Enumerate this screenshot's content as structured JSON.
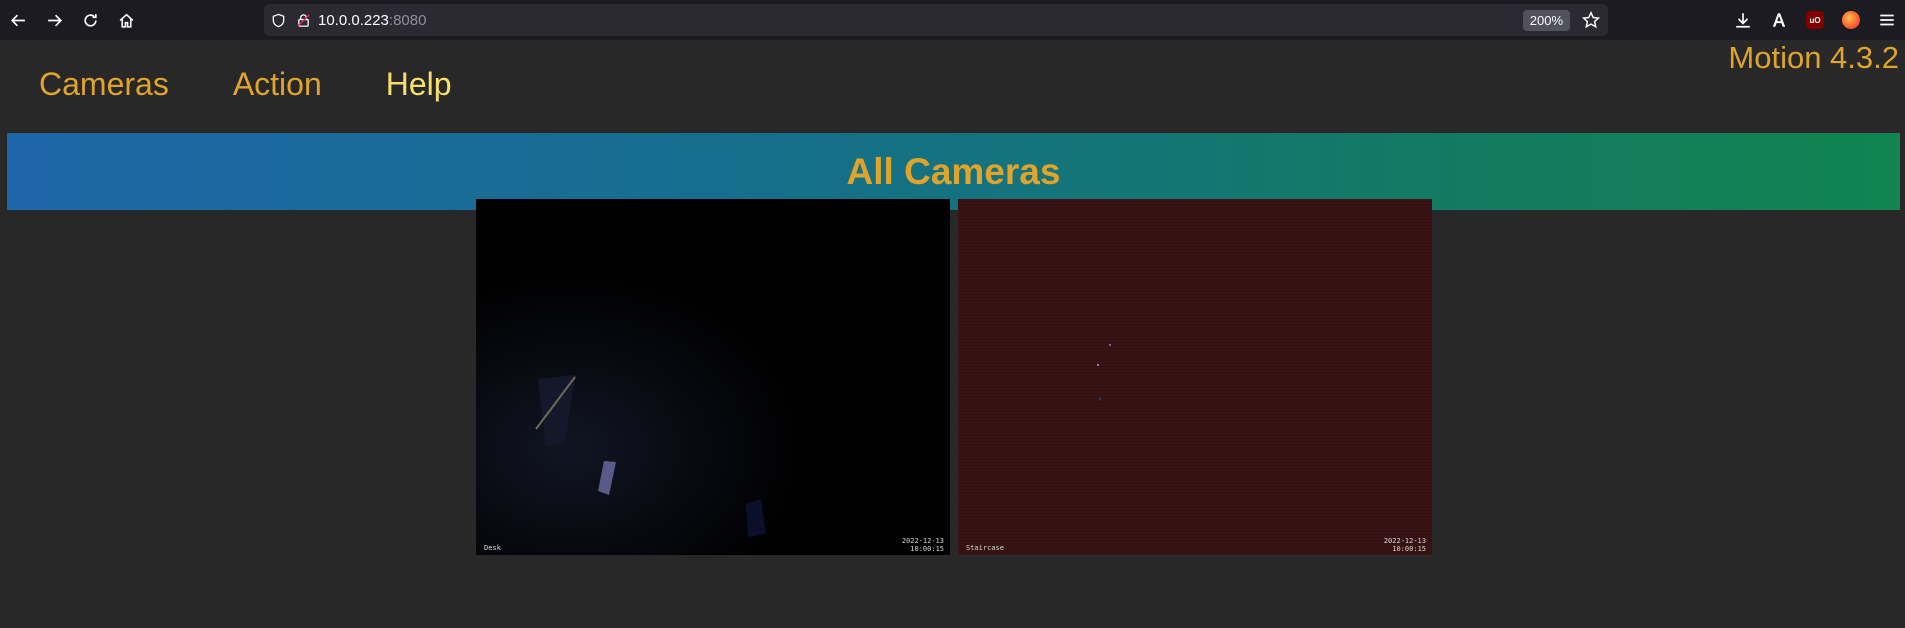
{
  "browser": {
    "url_host": "10.0.0.223",
    "url_port": ":8080",
    "zoom": "200%"
  },
  "icons": {
    "back": "back-arrow-icon",
    "forward": "forward-arrow-icon",
    "reload": "reload-icon",
    "home": "home-icon",
    "shield": "tracking-shield-icon",
    "lock": "insecure-lock-icon",
    "star": "bookmark-star-icon",
    "download": "download-icon",
    "reader": "font-a-icon",
    "ublock": "ublock-origin-icon",
    "fox": "firefox-account-icon",
    "menu": "hamburger-menu-icon"
  },
  "header": {
    "version": "Motion 4.3.2"
  },
  "menu": {
    "items": [
      {
        "label": "Cameras"
      },
      {
        "label": "Action"
      },
      {
        "label": "Help"
      }
    ]
  },
  "banner": {
    "title": "All Cameras"
  },
  "cameras": [
    {
      "label": "Desk",
      "date": "2022-12-13",
      "time": "10:00:15"
    },
    {
      "label": "Staircase",
      "date": "2022-12-13",
      "time": "10:00:15"
    }
  ],
  "colors": {
    "accent": "#e0a32b",
    "active": "#f7e06a",
    "background": "#282828"
  }
}
